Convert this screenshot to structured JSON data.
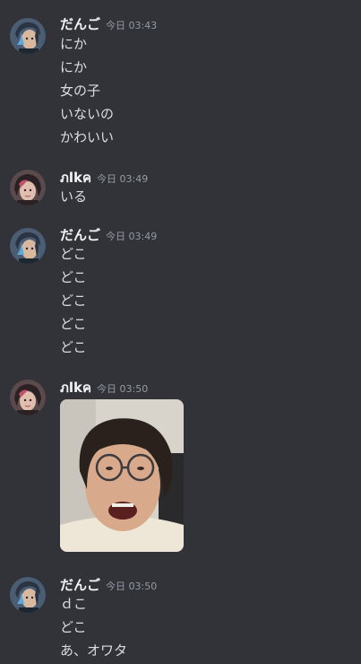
{
  "messages": [
    {
      "username": "だんご",
      "timestamp": "今日 03:43",
      "avatar_icon": "danngo-avatar-icon",
      "lines": [
        "にか",
        "にか",
        "女の子",
        "いないの",
        "かわいい"
      ]
    },
    {
      "username": "ภlkค",
      "timestamp": "今日 03:49",
      "avatar_icon": "nika-avatar-icon",
      "lines": [
        "いる"
      ]
    },
    {
      "username": "だんご",
      "timestamp": "今日 03:49",
      "avatar_icon": "danngo-avatar-icon",
      "lines": [
        "どこ",
        "どこ",
        "どこ",
        "どこ",
        "どこ"
      ]
    },
    {
      "username": "ภlkค",
      "timestamp": "今日 03:50",
      "avatar_icon": "nika-avatar-icon",
      "lines": [],
      "attachment": "image-attachment"
    },
    {
      "username": "だんご",
      "timestamp": "今日 03:50",
      "avatar_icon": "danngo-avatar-icon",
      "lines": [
        "ｄこ",
        "どこ",
        "あ、オワタ"
      ]
    }
  ],
  "colors": {
    "background": "#313338",
    "username": "#f2f3f5",
    "timestamp": "#949ba4",
    "message_text": "#dbdee1"
  }
}
